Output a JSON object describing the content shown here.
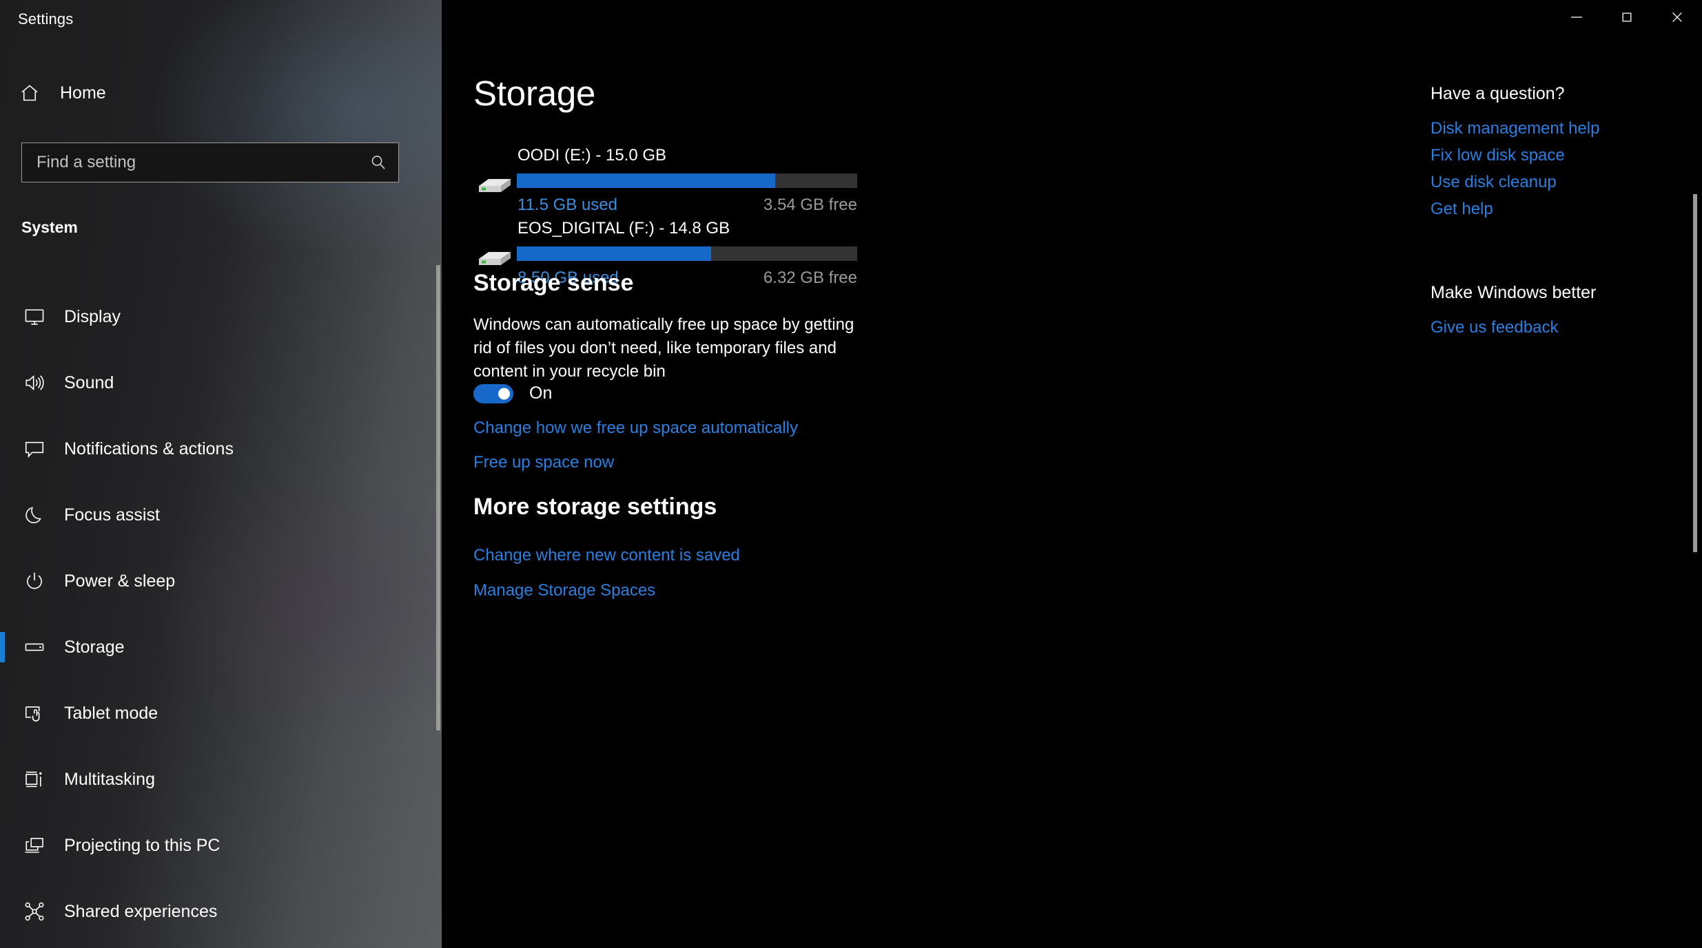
{
  "window": {
    "app_title": "Settings",
    "controls": [
      {
        "name": "minimize",
        "glyph": "minimize-icon"
      },
      {
        "name": "maximize",
        "glyph": "maximize-icon"
      },
      {
        "name": "close",
        "glyph": "close-icon"
      }
    ]
  },
  "sidebar": {
    "home_label": "Home",
    "home_icon": "home-icon",
    "search": {
      "placeholder": "Find a setting",
      "value": "",
      "icon": "search-icon"
    },
    "group_header": "System",
    "items": [
      {
        "label": "Display",
        "icon": "monitor-icon",
        "selected": false
      },
      {
        "label": "Sound",
        "icon": "speaker-icon",
        "selected": false
      },
      {
        "label": "Notifications & actions",
        "icon": "chat-bubble-icon",
        "selected": false
      },
      {
        "label": "Focus assist",
        "icon": "moon-icon",
        "selected": false
      },
      {
        "label": "Power & sleep",
        "icon": "power-icon",
        "selected": false
      },
      {
        "label": "Storage",
        "icon": "drive-icon",
        "selected": true
      },
      {
        "label": "Tablet mode",
        "icon": "tablet-touch-icon",
        "selected": false
      },
      {
        "label": "Multitasking",
        "icon": "multitasking-icon",
        "selected": false
      },
      {
        "label": "Projecting to this PC",
        "icon": "project-screen-icon",
        "selected": false
      },
      {
        "label": "Shared experiences",
        "icon": "share-nodes-icon",
        "selected": false
      }
    ]
  },
  "main": {
    "page_title": "Storage",
    "drives": [
      {
        "name": "OODI (E:) - 15.0 GB",
        "icon": "external-drive-icon",
        "used_label": "11.5 GB used",
        "free_label": "3.54 GB free",
        "used_gb": 11.5,
        "free_gb": 3.54,
        "total_gb": 15.0,
        "used_percent": 76
      },
      {
        "name": "EOS_DIGITAL (F:) - 14.8 GB",
        "icon": "external-drive-icon",
        "used_label": "8.50 GB used",
        "free_label": "6.32 GB free",
        "used_gb": 8.5,
        "free_gb": 6.32,
        "total_gb": 14.8,
        "used_percent": 57
      }
    ],
    "storage_sense": {
      "heading": "Storage sense",
      "description": "Windows can automatically free up space by getting rid of files you don’t need, like temporary files and content in your recycle bin",
      "toggle_state": "On",
      "toggle_on": true,
      "links": [
        "Change how we free up space automatically",
        "Free up space now"
      ]
    },
    "more_storage": {
      "heading": "More storage settings",
      "links": [
        "Change where new content is saved",
        "Manage Storage Spaces"
      ]
    }
  },
  "right_panel": {
    "question_heading": "Have a question?",
    "question_links": [
      "Disk management help",
      "Fix low disk space",
      "Use disk cleanup",
      "Get help"
    ],
    "better_heading": "Make Windows better",
    "better_links": [
      "Give us feedback"
    ]
  },
  "colors": {
    "accent_blue": "#1668c9",
    "link_blue": "#2a7fe0",
    "selection_blue": "#1a7fd4",
    "bar_track": "#333333",
    "free_text": "#9a9a9a"
  }
}
